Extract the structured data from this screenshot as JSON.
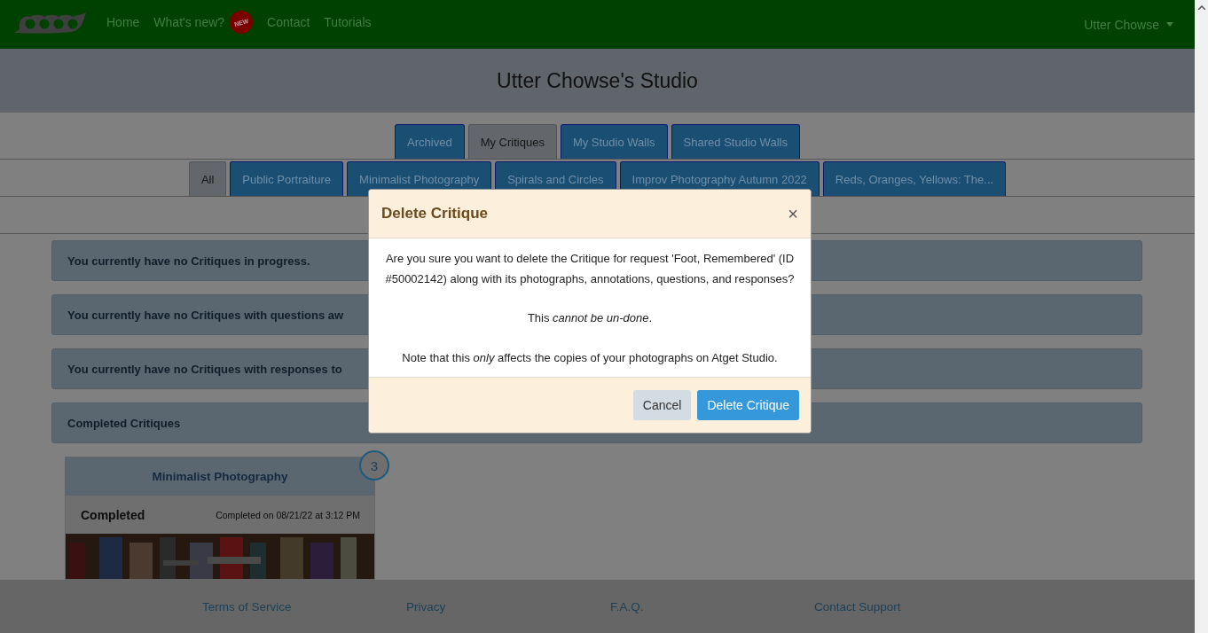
{
  "navbar": {
    "links": [
      {
        "label": "Home"
      },
      {
        "label": "What's new?",
        "badge": "NEW"
      },
      {
        "label": "Contact"
      },
      {
        "label": "Tutorials"
      }
    ],
    "user_menu": {
      "label": "Utter Chowse"
    }
  },
  "page_title": "Utter Chowse's Studio",
  "tabs": [
    {
      "label": "Archived",
      "selected": false
    },
    {
      "label": "My Critiques",
      "selected": true
    },
    {
      "label": "My Studio Walls",
      "selected": false
    },
    {
      "label": "Shared Studio Walls",
      "selected": false
    }
  ],
  "subtabs": [
    {
      "label": "All",
      "selected": true
    },
    {
      "label": "Public Portraiture",
      "selected": false
    },
    {
      "label": "Minimalist Photography",
      "selected": false
    },
    {
      "label": "Spirals and Circles",
      "selected": false
    },
    {
      "label": "Improv Photography Autumn 2022",
      "selected": false
    },
    {
      "label": "Reds, Oranges, Yellows: The...",
      "selected": false
    }
  ],
  "panels": [
    {
      "text": "You currently have no Critiques in progress."
    },
    {
      "text": "You currently have no Critiques with questions aw"
    },
    {
      "text": "You currently have no Critiques with responses to"
    },
    {
      "text": "Completed Critiques"
    }
  ],
  "card": {
    "title": "Minimalist Photography",
    "status": "Completed",
    "completed_on": "Completed on 08/21/22 at 3:12 PM",
    "count": "3"
  },
  "modal": {
    "title": "Delete Critique",
    "close": "×",
    "paragraphs": [
      "Are you sure you want to delete the Critique for request 'Foot, Remembered' (ID #50002142) along with its photographs, annotations, questions, and responses?",
      "This *cannot be un-done*.",
      "Note that this *only* affects the copies of your photographs on Atget Studio."
    ],
    "buttons": [
      {
        "label": "Cancel",
        "kind": "secondary"
      },
      {
        "label": "Delete Critique",
        "kind": "primary"
      }
    ]
  },
  "footer": {
    "links": [
      "Terms of Service",
      "Privacy",
      "F.A.Q.",
      "Contact Support"
    ]
  }
}
